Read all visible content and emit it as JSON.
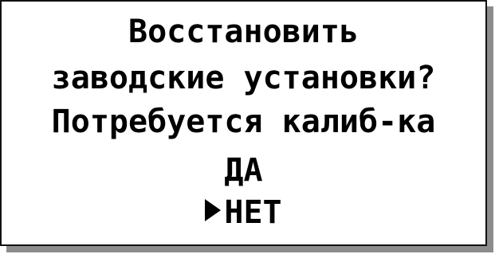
{
  "dialog": {
    "line1": "Восстановить",
    "line2": "заводские установки?",
    "line3": "Потребуется калиб-ка"
  },
  "options": {
    "yes_label": "ДА",
    "no_label": "НЕТ",
    "selected": "НЕТ",
    "cursor_icon": "triangle-right-icon"
  },
  "colors": {
    "background": "#ffffff",
    "text": "#000000",
    "shadow": "#8c8c8c"
  }
}
